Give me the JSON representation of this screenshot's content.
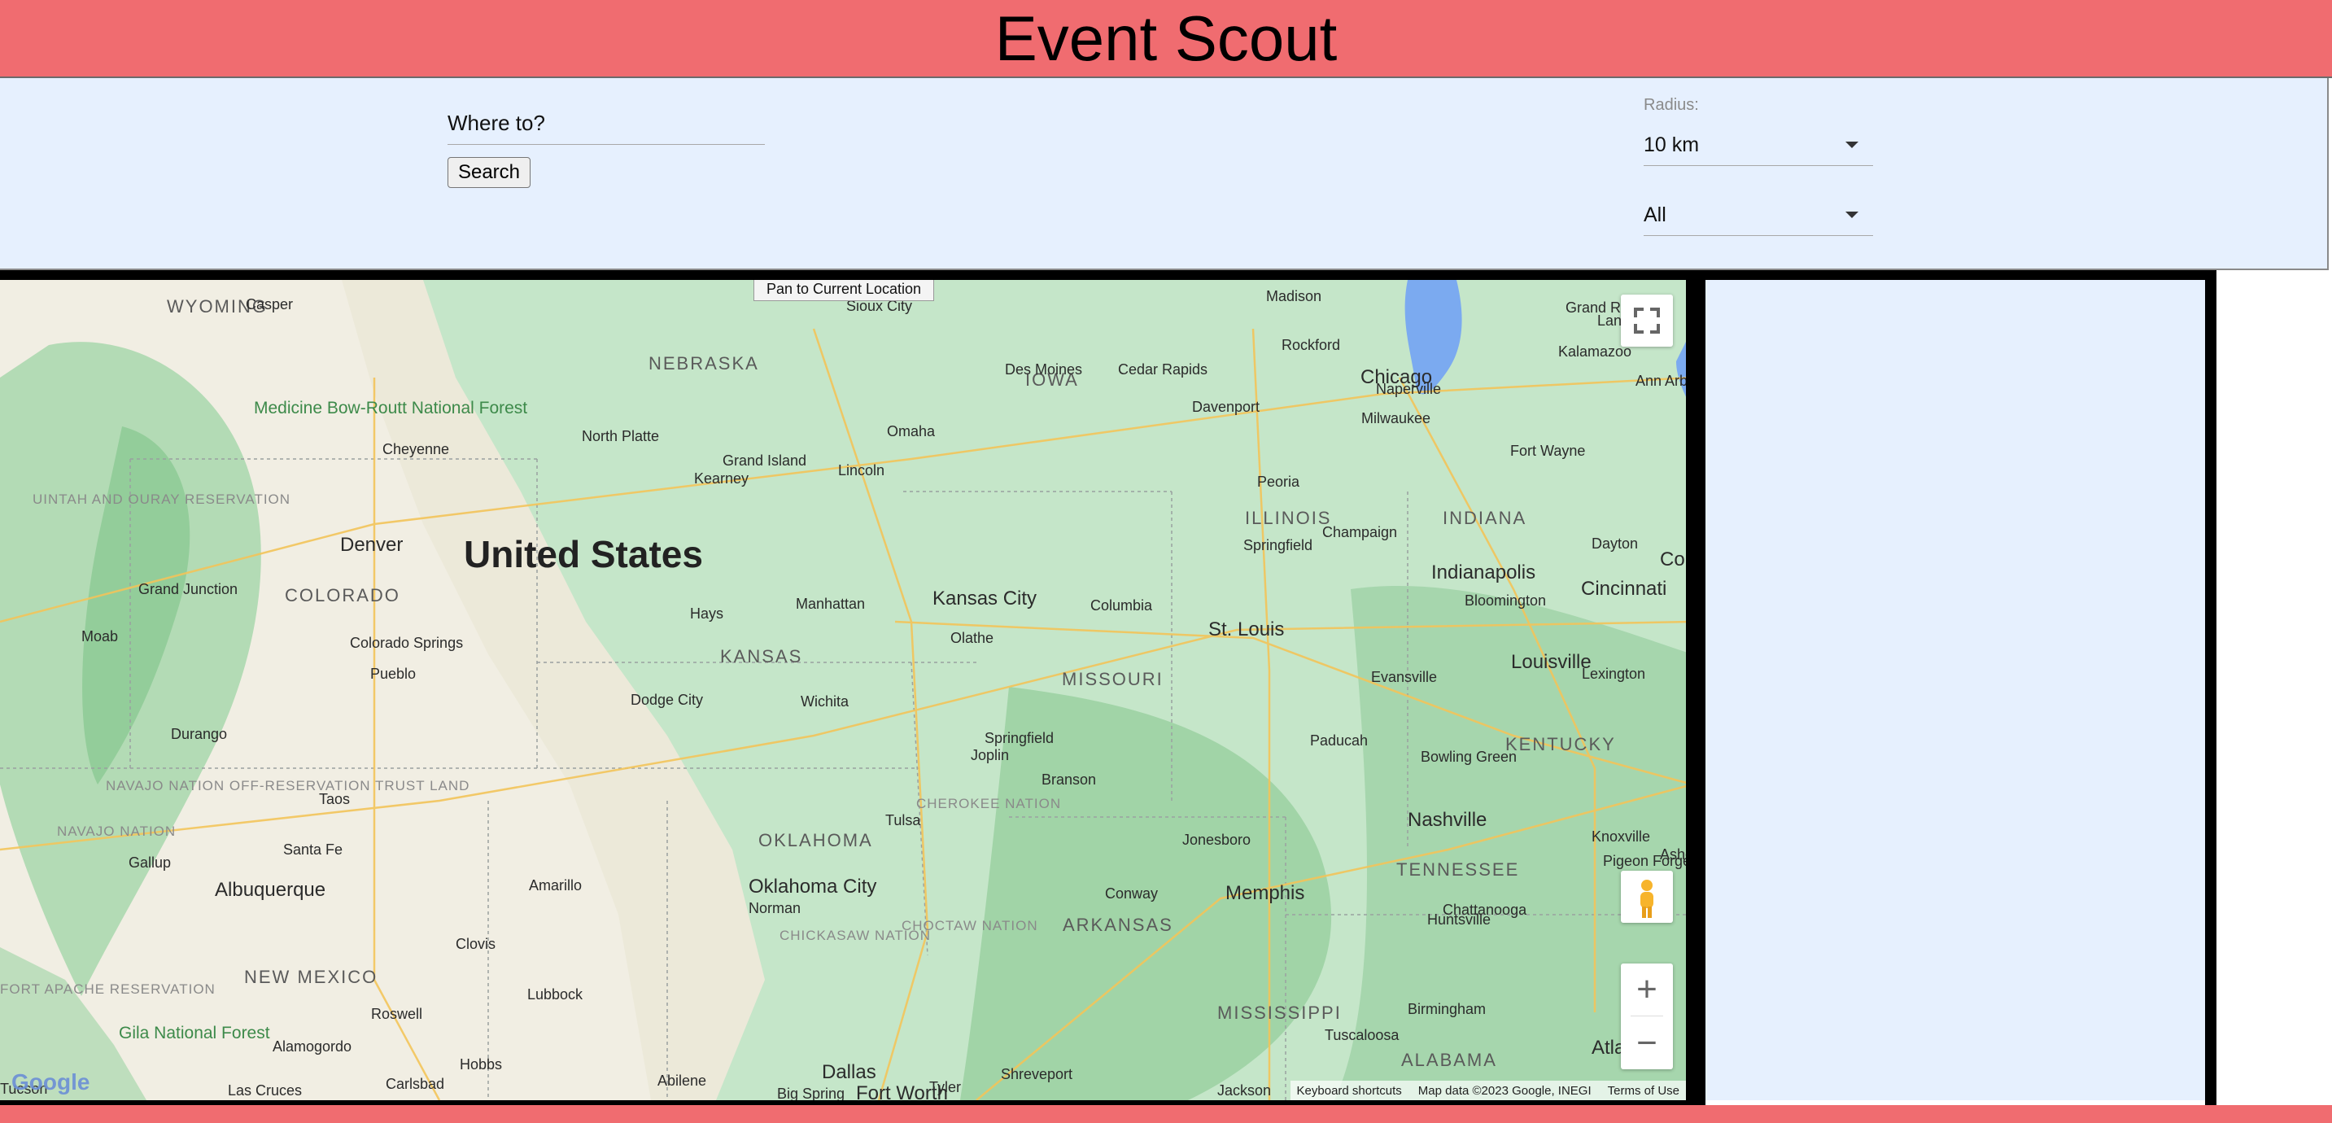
{
  "header": {
    "title": "Event Scout"
  },
  "search": {
    "placeholder": "Where to?",
    "button_label": "Search"
  },
  "filters": {
    "radius_label": "Radius:",
    "radius_value": "10 km",
    "category_value": "All"
  },
  "map": {
    "pan_button": "Pan to Current Location",
    "logo": "Google",
    "attribution": {
      "keyboard": "Keyboard shortcuts",
      "data": "Map data ©2023 Google, INEGI",
      "terms": "Terms of Use"
    },
    "controls": {
      "fullscreen_icon": "fullscreen-icon",
      "pegman_icon": "pegman-icon",
      "zoom_in": "+",
      "zoom_out": "−"
    },
    "labels": {
      "country": "United States",
      "states": [
        "WYOMING",
        "NEBRASKA",
        "IOWA",
        "ILLINOIS",
        "INDIANA",
        "COLORADO",
        "KANSAS",
        "MISSOURI",
        "KENTUCKY",
        "OKLAHOMA",
        "TENNESSEE",
        "ARKANSAS",
        "NEW MEXICO",
        "MISSISSIPPI",
        "ALABAMA"
      ],
      "cities": [
        "Casper",
        "Cheyenne",
        "Denver",
        "Grand Junction",
        "Moab",
        "Colorado Springs",
        "Pueblo",
        "Durango",
        "Taos",
        "Santa Fe",
        "Gallup",
        "Albuquerque",
        "Roswell",
        "Alamogordo",
        "Las Cruces",
        "Carlsbad",
        "Hobbs",
        "Lubbock",
        "Amarillo",
        "Clovis",
        "Abilene",
        "Big Spring",
        "Fort Worth",
        "Dallas",
        "Tyler",
        "Shreveport",
        "Norman",
        "Oklahoma City",
        "Tulsa",
        "Wichita",
        "Dodge City",
        "Hays",
        "Manhattan",
        "Kansas City",
        "Olathe",
        "Joplin",
        "Springfield",
        "Branson",
        "Columbia",
        "St. Louis",
        "North Platte",
        "Grand Island",
        "Kearney",
        "Lincoln",
        "Omaha",
        "Sioux City",
        "Des Moines",
        "Cedar Rapids",
        "Davenport",
        "Rockford",
        "Chicago",
        "Milwaukee",
        "Naperville",
        "Peoria",
        "Champaign",
        "Springfield",
        "Evansville",
        "Paducah",
        "Bowling Green",
        "Nashville",
        "Jonesboro",
        "Memphis",
        "Conway",
        "Huntsville",
        "Birmingham",
        "Tuscaloosa",
        "Chattanooga",
        "Knoxville",
        "Atlanta",
        "Lexington",
        "Louisville",
        "Cincinnati",
        "Dayton",
        "Indianapolis",
        "Bloomington",
        "Fort Wayne",
        "Kalamazoo",
        "Ann Arbor",
        "Grand Rapids",
        "Lansing",
        "Madison",
        "Jackson",
        "Pigeon Forge",
        "Columbus",
        "Tucson",
        "Ashe"
      ],
      "reservations": [
        "UINTAH AND OURAY RESERVATION",
        "NAVAJO NATION OFF-RESERVATION TRUST LAND",
        "NAVAJO NATION",
        "FORT APACHE RESERVATION",
        "CHEROKEE NATION",
        "CHICKASAW NATION",
        "CHOCTAW NATION"
      ],
      "parks": [
        "Medicine Bow-Routt National Forest",
        "Gila National Forest"
      ]
    }
  }
}
